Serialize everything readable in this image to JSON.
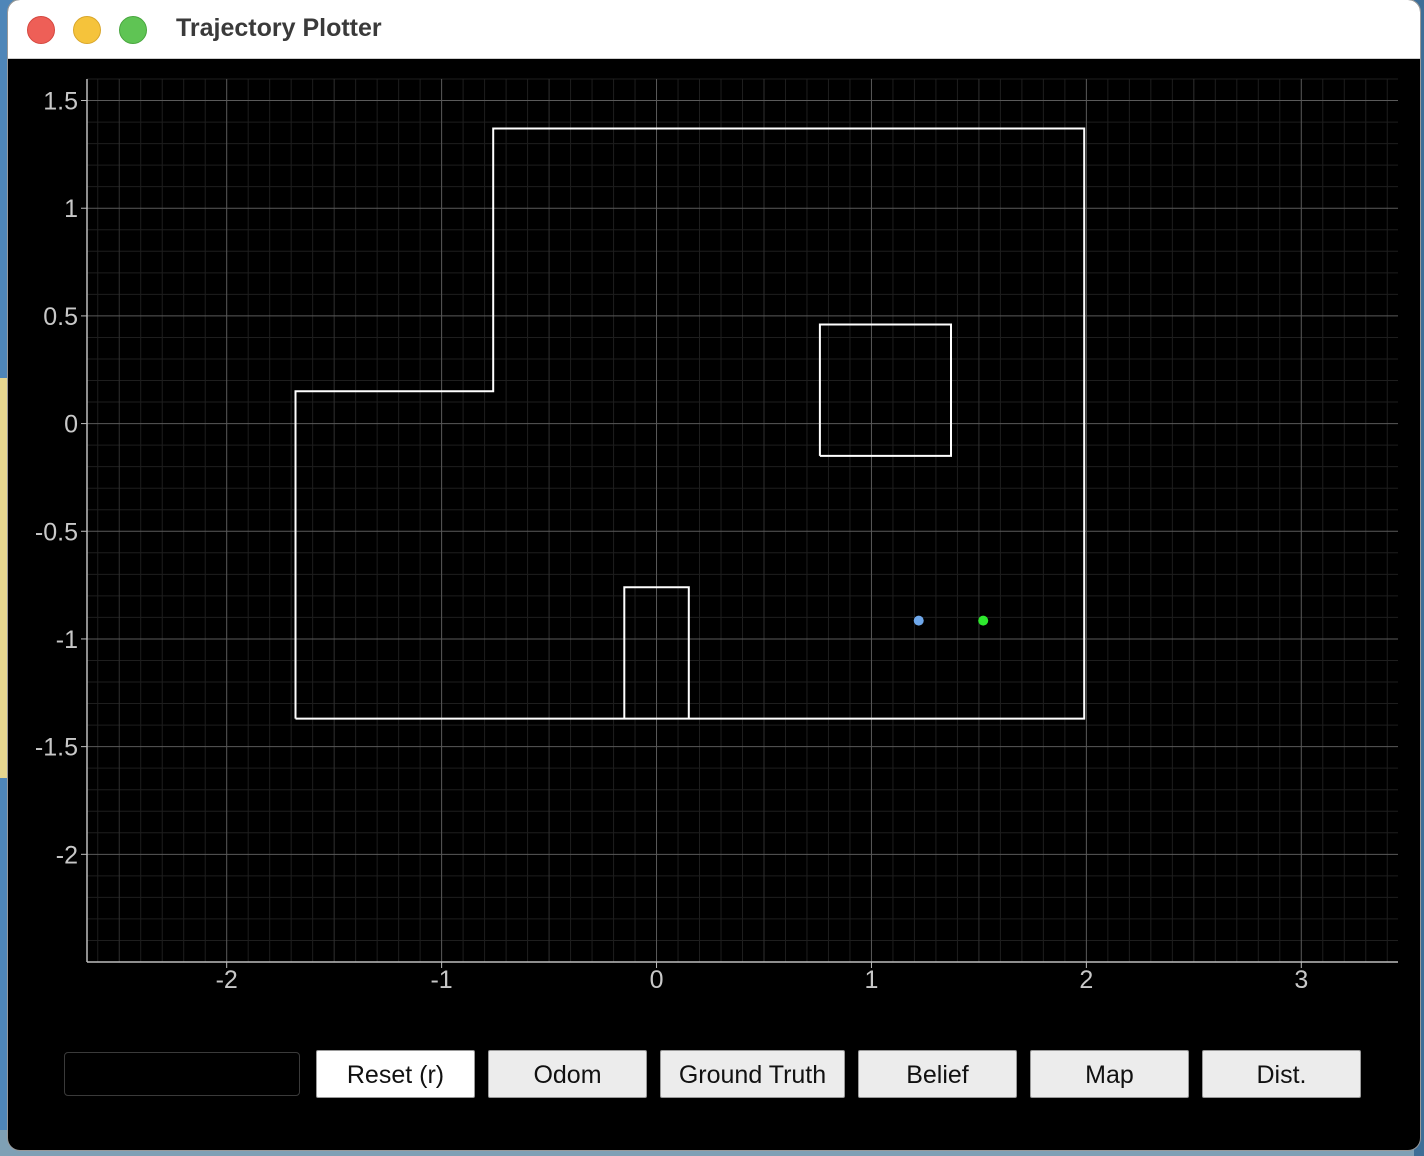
{
  "window": {
    "title": "Trajectory Plotter"
  },
  "chart_data": {
    "type": "scatter",
    "xlim": [
      -2.65,
      3.45
    ],
    "ylim": [
      -2.5,
      1.6
    ],
    "x_ticks": [
      -2,
      -1,
      0,
      1,
      2,
      3
    ],
    "x_tick_labels": [
      "-2",
      "-1",
      "0",
      "1",
      "2",
      "3"
    ],
    "y_ticks": [
      1.5,
      1,
      0.5,
      0,
      -0.5,
      -1,
      -1.5,
      -2
    ],
    "y_tick_labels": [
      "1.5",
      "1",
      "0.5",
      "0",
      "-0.5",
      "-1",
      "-1.5",
      "-2"
    ],
    "grid": true,
    "map_walls": [
      {
        "name": "outer-boundary",
        "points": [
          [
            -1.68,
            -1.37
          ],
          [
            -1.68,
            0.15
          ],
          [
            -0.76,
            0.15
          ],
          [
            -0.76,
            1.37
          ],
          [
            1.99,
            1.37
          ],
          [
            1.99,
            -1.37
          ],
          [
            -1.68,
            -1.37
          ]
        ]
      },
      {
        "name": "box-obstacle",
        "points": [
          [
            0.76,
            -0.15
          ],
          [
            0.76,
            0.46
          ],
          [
            1.37,
            0.46
          ],
          [
            1.37,
            -0.15
          ],
          [
            0.76,
            -0.15
          ]
        ]
      },
      {
        "name": "bottom-obstacle",
        "points": [
          [
            -0.15,
            -1.37
          ],
          [
            -0.15,
            -0.76
          ],
          [
            0.15,
            -0.76
          ],
          [
            0.15,
            -1.37
          ]
        ]
      }
    ],
    "points": [
      {
        "name": "belief-point",
        "x": 1.22,
        "y": -0.915,
        "color": "#6ea7ea"
      },
      {
        "name": "ground-truth-point",
        "x": 1.52,
        "y": -0.915,
        "color": "#2ee82e"
      }
    ]
  },
  "controls": {
    "input_value": "",
    "buttons": [
      "Reset (r)",
      "Odom",
      "Ground Truth",
      "Belief",
      "Map",
      "Dist."
    ]
  }
}
